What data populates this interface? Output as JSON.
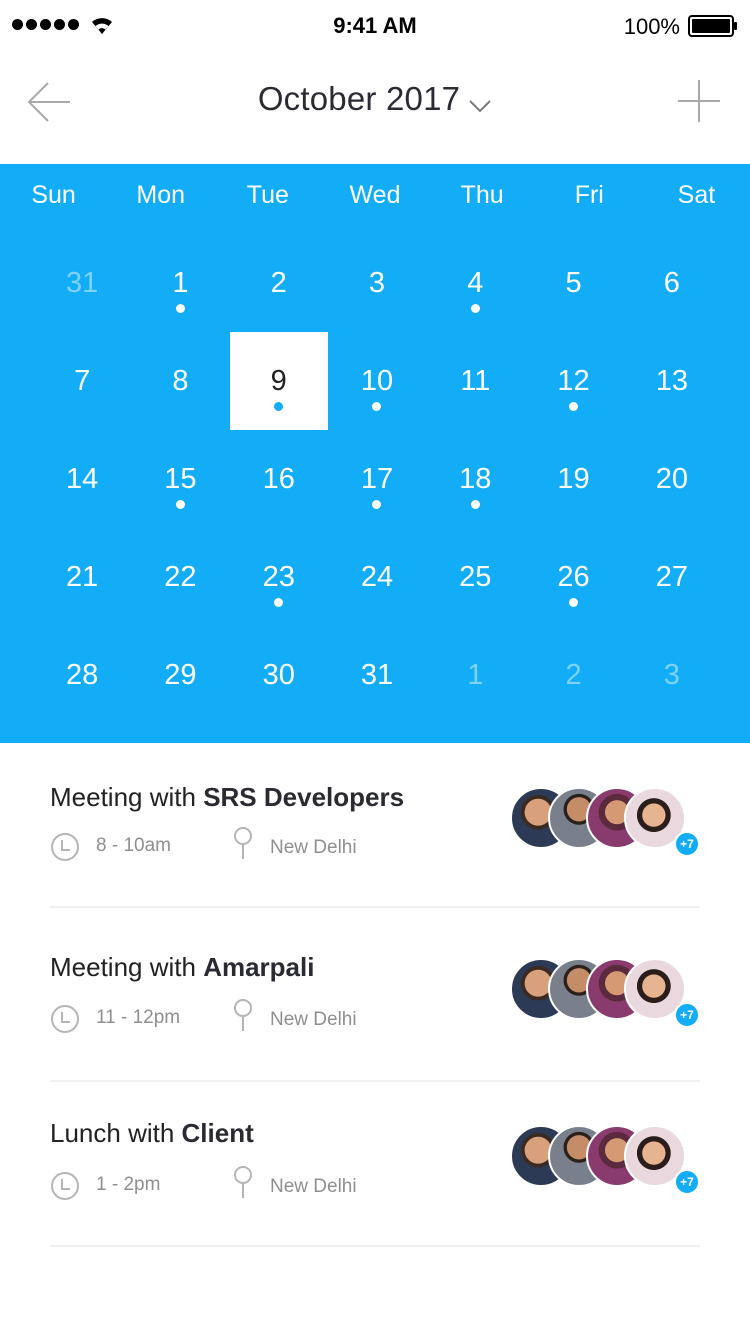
{
  "status": {
    "time": "9:41 AM",
    "battery": "100%"
  },
  "header": {
    "title": "October 2017"
  },
  "calendar": {
    "weekdays": [
      "Sun",
      "Mon",
      "Tue",
      "Wed",
      "Thu",
      "Fri",
      "Sat"
    ],
    "weeks": [
      [
        {
          "d": "31",
          "muted": true,
          "dot": false
        },
        {
          "d": "1",
          "dot": true
        },
        {
          "d": "2",
          "dot": false
        },
        {
          "d": "3",
          "dot": false
        },
        {
          "d": "4",
          "dot": true
        },
        {
          "d": "5",
          "dot": false
        },
        {
          "d": "6",
          "dot": false
        }
      ],
      [
        {
          "d": "7",
          "dot": false
        },
        {
          "d": "8",
          "dot": false
        },
        {
          "d": "9",
          "dot": true,
          "selected": true
        },
        {
          "d": "10",
          "dot": true
        },
        {
          "d": "11",
          "dot": false
        },
        {
          "d": "12",
          "dot": true
        },
        {
          "d": "13",
          "dot": false
        }
      ],
      [
        {
          "d": "14",
          "dot": false
        },
        {
          "d": "15",
          "dot": true
        },
        {
          "d": "16",
          "dot": false
        },
        {
          "d": "17",
          "dot": true
        },
        {
          "d": "18",
          "dot": true
        },
        {
          "d": "19",
          "dot": false
        },
        {
          "d": "20",
          "dot": false
        }
      ],
      [
        {
          "d": "21",
          "dot": false
        },
        {
          "d": "22",
          "dot": false
        },
        {
          "d": "23",
          "dot": true
        },
        {
          "d": "24",
          "dot": false
        },
        {
          "d": "25",
          "dot": false
        },
        {
          "d": "26",
          "dot": true
        },
        {
          "d": "27",
          "dot": false
        }
      ],
      [
        {
          "d": "28",
          "dot": false
        },
        {
          "d": "29",
          "dot": false
        },
        {
          "d": "30",
          "dot": false
        },
        {
          "d": "31",
          "dot": false
        },
        {
          "d": "1",
          "muted": true,
          "dot": false
        },
        {
          "d": "2",
          "muted": true,
          "dot": false
        },
        {
          "d": "3",
          "muted": true,
          "dot": false
        }
      ]
    ]
  },
  "events": [
    {
      "prefix": "Meeting with ",
      "name": "SRS Developers",
      "time": "8 - 10am",
      "location": "New Delhi",
      "extra": "+7"
    },
    {
      "prefix": "Meeting with ",
      "name": "Amarpali",
      "time": "11 - 12pm",
      "location": "New Delhi",
      "extra": "+7"
    },
    {
      "prefix": "Lunch with ",
      "name": "Client",
      "time": "1 - 2pm",
      "location": "New Delhi",
      "extra": "+7"
    }
  ],
  "colors": {
    "accent": "#12adf6",
    "muted_text": "#8f8f8f"
  },
  "icons": [
    "signal-icon",
    "wifi-icon",
    "battery-icon",
    "back-arrow-icon",
    "chevron-down-icon",
    "plus-icon",
    "clock-icon",
    "location-pin-icon"
  ]
}
